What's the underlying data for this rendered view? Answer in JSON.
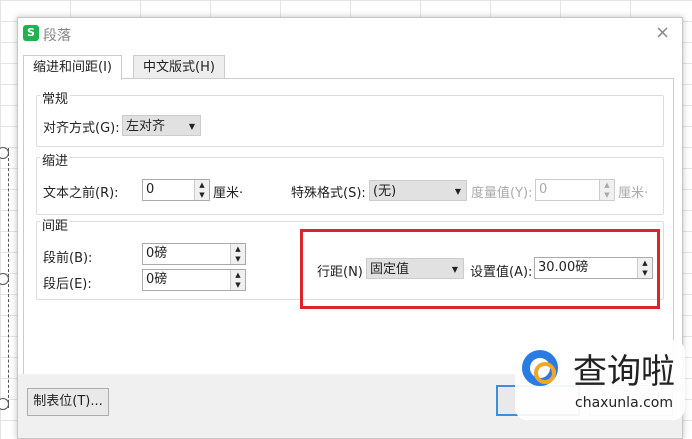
{
  "dialog": {
    "title": "段落",
    "logo": "S",
    "close": "×"
  },
  "tabs": [
    {
      "label": "缩进和间距(I)",
      "active": true
    },
    {
      "label": "中文版式(H)",
      "active": false
    }
  ],
  "general": {
    "title": "常规",
    "align_label": "对齐方式(G):",
    "align_value": "左对齐"
  },
  "indent": {
    "title": "缩进",
    "before_label": "文本之前(R):",
    "before_value": "0",
    "before_unit": "厘米·",
    "special_label": "特殊格式(S):",
    "special_value": "(无)",
    "measure_label": "度量值(Y):",
    "measure_value": "0",
    "measure_unit": "厘米·"
  },
  "spacing": {
    "title": "间距",
    "before_label": "段前(B):",
    "before_value": "0磅",
    "after_label": "段后(E):",
    "after_value": "0磅",
    "line_label": "行距(N)",
    "line_value": "固定值",
    "set_label": "设置值(A):",
    "set_value": "30.00磅"
  },
  "buttons": {
    "tabs": "制表位(T)..."
  },
  "watermark": {
    "text": "查询啦",
    "url": "chaxunla.com"
  },
  "colors": {
    "highlight": "#d9262c",
    "accent": "#22b14c"
  }
}
